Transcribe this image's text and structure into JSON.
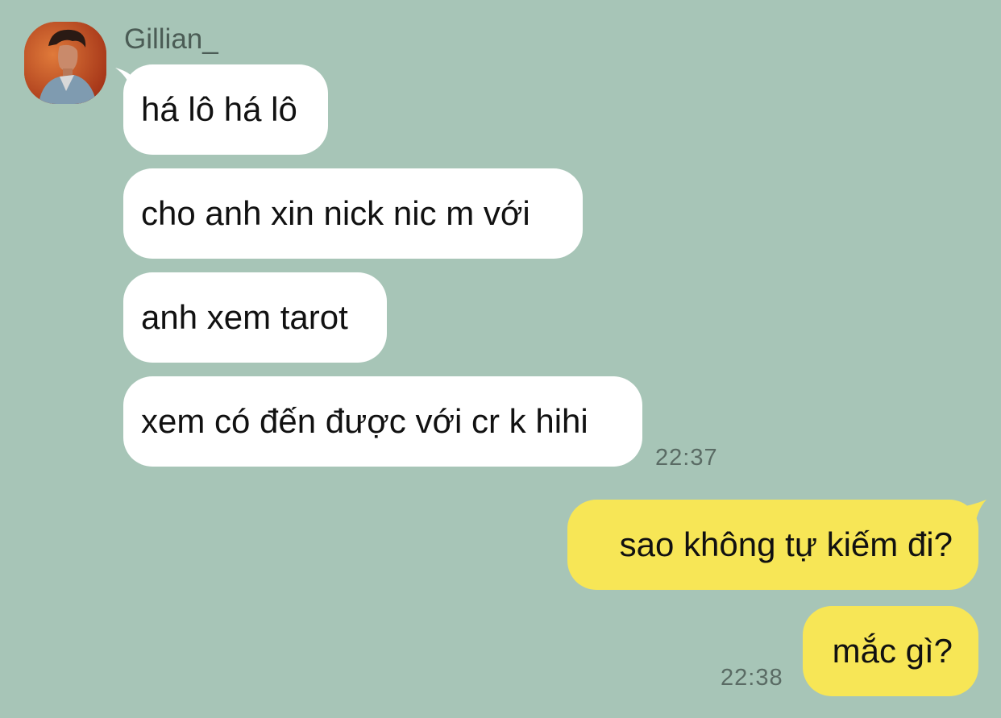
{
  "contact": {
    "name": "Gillian_",
    "avatar_icon": "profile-photo-avatar"
  },
  "messages": [
    {
      "side": "incoming",
      "text": "há lô há lô"
    },
    {
      "side": "incoming",
      "text": "cho anh xin nick nic m với"
    },
    {
      "side": "incoming",
      "text": "anh xem tarot"
    },
    {
      "side": "incoming",
      "text": "xem có đến được với cr k hihi"
    },
    {
      "side": "outgoing",
      "text": "sao không tự kiếm đi?"
    },
    {
      "side": "outgoing",
      "text": "mắc gì?"
    }
  ],
  "timestamps": {
    "incoming_group": "22:37",
    "outgoing_group": "22:38"
  },
  "colors": {
    "background": "#a7c5b7",
    "incoming_bubble": "#ffffff",
    "outgoing_bubble": "#f7e656"
  }
}
